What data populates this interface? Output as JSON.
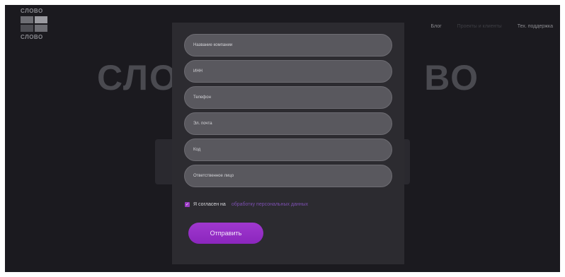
{
  "logo": {
    "top": "СЛОВО",
    "bottom": "СЛОВО"
  },
  "nav": [
    {
      "label": "Блог",
      "dim": false
    },
    {
      "label": "Проекты и клиенты",
      "dim": true
    },
    {
      "label": "Тех. поддержка",
      "dim": false
    }
  ],
  "hero": {
    "left": "СЛО",
    "right": "ВО"
  },
  "form": {
    "fields": [
      {
        "name": "company-name-field",
        "placeholder": "Название компании"
      },
      {
        "name": "inn-field",
        "placeholder": "ИНН"
      },
      {
        "name": "phone-field",
        "placeholder": "Телефон"
      },
      {
        "name": "email-field",
        "placeholder": "Эл. почта"
      },
      {
        "name": "code-field",
        "placeholder": "Код"
      },
      {
        "name": "responsible-person-field",
        "placeholder": "Ответственное лицо"
      }
    ],
    "consent_text": "Я согласен на",
    "consent_link": "обработку персональных данных",
    "checkbox_checked": true,
    "submit_label": "Отправить"
  },
  "colors": {
    "accent": "#9b34c9",
    "background": "#1b1a1f",
    "modal": "#2c2b30"
  }
}
